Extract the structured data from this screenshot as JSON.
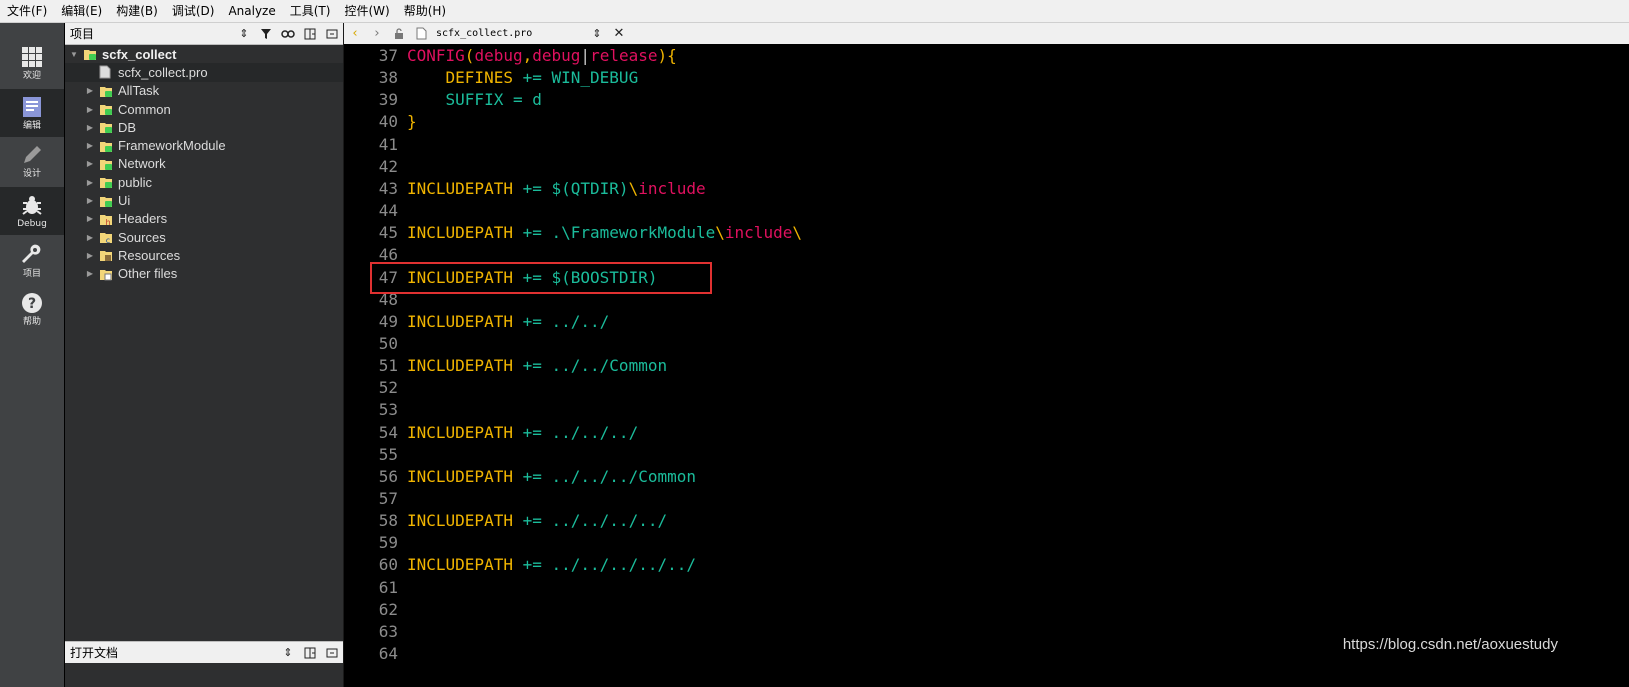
{
  "menu": [
    "文件(F)",
    "编辑(E)",
    "构建(B)",
    "调试(D)",
    "Analyze",
    "工具(T)",
    "控件(W)",
    "帮助(H)"
  ],
  "modes": [
    {
      "label": "欢迎",
      "icon": "grid-icon"
    },
    {
      "label": "编辑",
      "icon": "edit-document-icon"
    },
    {
      "label": "设计",
      "icon": "pencil-icon"
    },
    {
      "label": "Debug",
      "icon": "bug-icon"
    },
    {
      "label": "项目",
      "icon": "wrench-icon"
    },
    {
      "label": "帮助",
      "icon": "help-icon"
    }
  ],
  "project_pane": {
    "title": "项目",
    "open_docs_title": "打开文档",
    "tree": [
      {
        "label": "scfx_collect",
        "level": 0,
        "icon": "project-folder-icon",
        "bold": true
      },
      {
        "label": "scfx_collect.pro",
        "level": 1,
        "icon": "pro-file-icon",
        "selected": true
      },
      {
        "label": "AllTask",
        "level": 1,
        "icon": "project-folder-icon"
      },
      {
        "label": "Common",
        "level": 1,
        "icon": "project-folder-icon"
      },
      {
        "label": "DB",
        "level": 1,
        "icon": "project-folder-icon"
      },
      {
        "label": "FrameworkModule",
        "level": 1,
        "icon": "project-folder-icon"
      },
      {
        "label": "Network",
        "level": 1,
        "icon": "project-folder-icon"
      },
      {
        "label": "public",
        "level": 1,
        "icon": "project-folder-icon"
      },
      {
        "label": "Ui",
        "level": 1,
        "icon": "project-folder-icon"
      },
      {
        "label": "Headers",
        "level": 1,
        "icon": "headers-folder-icon"
      },
      {
        "label": "Sources",
        "level": 1,
        "icon": "sources-folder-icon"
      },
      {
        "label": "Resources",
        "level": 1,
        "icon": "resources-folder-icon"
      },
      {
        "label": "Other files",
        "level": 1,
        "icon": "other-files-folder-icon"
      }
    ]
  },
  "editor": {
    "filename": "scfx_collect.pro",
    "lines": [
      {
        "n": "37",
        "segs": [
          [
            "CONFIG",
            "k-mag"
          ],
          [
            "(",
            "k-yel"
          ],
          [
            "debug",
            "k-mag"
          ],
          [
            ",",
            "k-yel"
          ],
          [
            "debug",
            "k-mag"
          ],
          [
            "|",
            "k-wht"
          ],
          [
            "release",
            "k-mag"
          ],
          [
            "){",
            "k-yel"
          ]
        ]
      },
      {
        "n": "38",
        "segs": [
          [
            "    DEFINES ",
            "k-yel"
          ],
          [
            "+= ",
            "k-cyn"
          ],
          [
            "WIN_DEBUG",
            "k-cyn"
          ]
        ]
      },
      {
        "n": "39",
        "segs": [
          [
            "    SUFFIX ",
            "k-cyn"
          ],
          [
            "= d",
            "k-cyn"
          ]
        ]
      },
      {
        "n": "40",
        "segs": [
          [
            "}",
            "k-yel"
          ]
        ]
      },
      {
        "n": "41",
        "segs": []
      },
      {
        "n": "42",
        "segs": []
      },
      {
        "n": "43",
        "segs": [
          [
            "INCLUDEPATH ",
            "k-yel"
          ],
          [
            "+= ",
            "k-cyn"
          ],
          [
            "$(QTDIR)",
            "k-cyn"
          ],
          [
            "\\",
            "k-yel"
          ],
          [
            "include",
            "k-mag"
          ]
        ]
      },
      {
        "n": "44",
        "segs": []
      },
      {
        "n": "45",
        "segs": [
          [
            "INCLUDEPATH ",
            "k-yel"
          ],
          [
            "+= ",
            "k-cyn"
          ],
          [
            ".\\FrameworkModule",
            "k-cyn"
          ],
          [
            "\\",
            "k-yel"
          ],
          [
            "include",
            "k-mag"
          ],
          [
            "\\",
            "k-yel"
          ]
        ]
      },
      {
        "n": "46",
        "segs": []
      },
      {
        "n": "47",
        "segs": [
          [
            "INCLUDEPATH ",
            "k-yel"
          ],
          [
            "+= ",
            "k-cyn"
          ],
          [
            "$(BOOSTDIR)",
            "k-cyn"
          ]
        ]
      },
      {
        "n": "48",
        "segs": []
      },
      {
        "n": "49",
        "segs": [
          [
            "INCLUDEPATH ",
            "k-yel"
          ],
          [
            "+= ",
            "k-cyn"
          ],
          [
            "../../",
            "k-cyn"
          ]
        ]
      },
      {
        "n": "50",
        "segs": []
      },
      {
        "n": "51",
        "segs": [
          [
            "INCLUDEPATH ",
            "k-yel"
          ],
          [
            "+= ",
            "k-cyn"
          ],
          [
            "../../Common",
            "k-cyn"
          ]
        ]
      },
      {
        "n": "52",
        "segs": []
      },
      {
        "n": "53",
        "segs": []
      },
      {
        "n": "54",
        "segs": [
          [
            "INCLUDEPATH ",
            "k-yel"
          ],
          [
            "+= ",
            "k-cyn"
          ],
          [
            "../../../",
            "k-cyn"
          ]
        ]
      },
      {
        "n": "55",
        "segs": []
      },
      {
        "n": "56",
        "segs": [
          [
            "INCLUDEPATH ",
            "k-yel"
          ],
          [
            "+= ",
            "k-cyn"
          ],
          [
            "../../../Common",
            "k-cyn"
          ]
        ]
      },
      {
        "n": "57",
        "segs": []
      },
      {
        "n": "58",
        "segs": [
          [
            "INCLUDEPATH ",
            "k-yel"
          ],
          [
            "+= ",
            "k-cyn"
          ],
          [
            "../../../../",
            "k-cyn"
          ]
        ]
      },
      {
        "n": "59",
        "segs": []
      },
      {
        "n": "60",
        "segs": [
          [
            "INCLUDEPATH ",
            "k-yel"
          ],
          [
            "+= ",
            "k-cyn"
          ],
          [
            "../../../../../",
            "k-cyn"
          ]
        ]
      },
      {
        "n": "61",
        "segs": []
      },
      {
        "n": "62",
        "segs": []
      },
      {
        "n": "63",
        "segs": []
      },
      {
        "n": "64",
        "segs": []
      }
    ]
  },
  "watermark": "https://blog.csdn.net/aoxuestudy",
  "colors": {
    "keyword": "#e0115f",
    "variable": "#f0b400",
    "value": "#1bbc9b",
    "highlight_box": "#e03131"
  }
}
